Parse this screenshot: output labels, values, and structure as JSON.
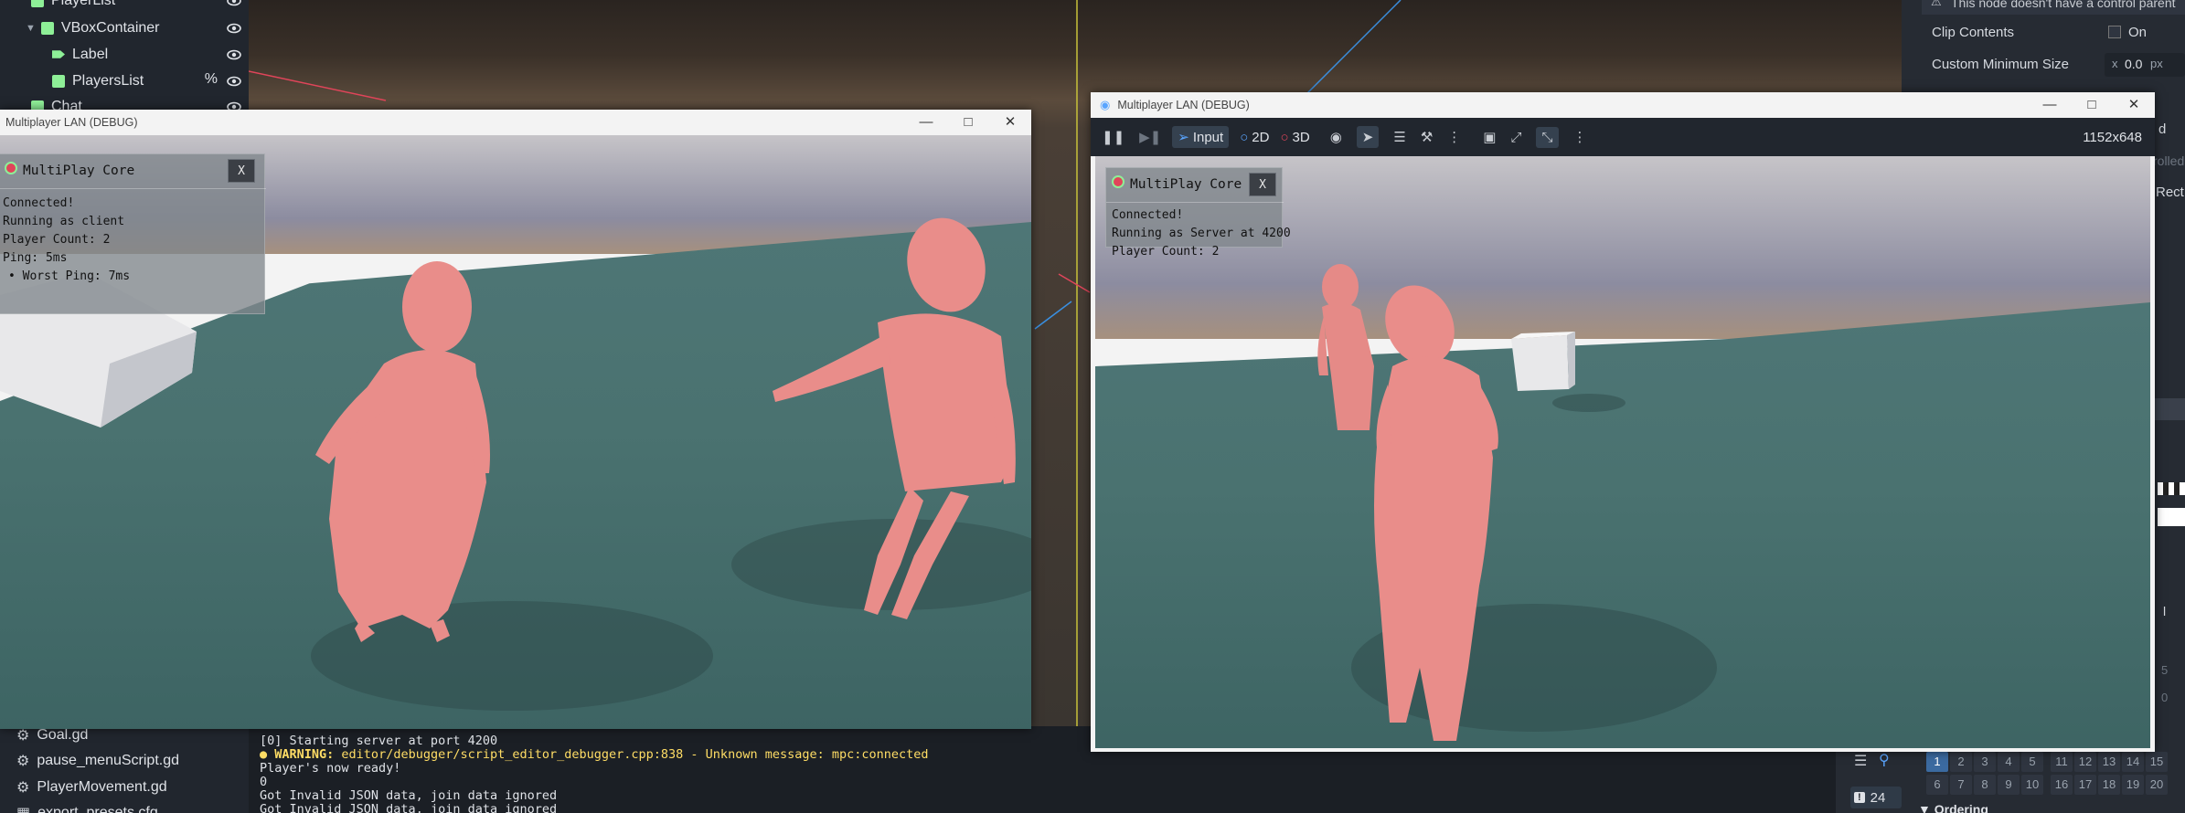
{
  "scene_tree": {
    "items": [
      {
        "label": "PlayerList",
        "depth": 1,
        "color": "#8eef97"
      },
      {
        "label": "VBoxContainer",
        "depth": 2,
        "color": "#8eef97"
      },
      {
        "label": "Label",
        "depth": 3,
        "color": "#8eef97"
      },
      {
        "label": "PlayersList",
        "depth": 3,
        "color": "#8eef97",
        "extra": "%"
      },
      {
        "label": "Chat",
        "depth": 1,
        "color": "#8eef97"
      }
    ]
  },
  "filesystem": {
    "items": [
      "Goal.gd",
      "pause_menuScript.gd",
      "PlayerMovement.gd",
      "export_presets.cfg"
    ]
  },
  "output": {
    "lines": [
      {
        "text": "[0] Starting server at port 4200",
        "kind": "normal"
      },
      {
        "prefix": "WARNING:",
        "text": " editor/debugger/script_editor_debugger.cpp:838 - Unknown message: mpc:connected",
        "kind": "warning"
      },
      {
        "text": "Player's now ready!",
        "kind": "normal"
      },
      {
        "text": "0",
        "kind": "normal"
      },
      {
        "text": "Got Invalid JSON data, join data ignored",
        "kind": "normal"
      },
      {
        "text": "Got Invalid JSON data, join data ignored",
        "kind": "normal"
      }
    ],
    "counter": "24"
  },
  "inspector": {
    "notice": "This node doesn't have a control parent",
    "clip_contents_label": "Clip Contents",
    "clip_contents_value": "On",
    "min_size_label": "Custom Minimum Size",
    "min_size_x_prefix": "x",
    "min_size_x_value": "0.0",
    "min_size_unit": "px",
    "frag_d": "d",
    "frag_rolled": "rolled",
    "frag_rect": "Rect",
    "frag_l": "l",
    "frag_5": "5",
    "frag_0": "0",
    "layers_row1": [
      "1",
      "2",
      "3",
      "4",
      "5",
      "6",
      "7",
      "8",
      "9",
      "10"
    ],
    "layers_row1b": [
      "11",
      "12",
      "13",
      "14",
      "15"
    ],
    "layers_row2": [
      "16",
      "17",
      "18",
      "19",
      "20"
    ],
    "ordering_label": "Ordering"
  },
  "client_window": {
    "title": "Multiplayer LAN (DEBUG)",
    "overlay": {
      "title": "MultiPlay Core",
      "close": "X",
      "lines": [
        "Connected!",
        "Running as client",
        "Player Count: 2",
        "Ping: 5ms",
        "• Worst Ping: 7ms"
      ]
    }
  },
  "server_window": {
    "title": "Multiplayer LAN (DEBUG)",
    "toolbar": {
      "input_label": "Input",
      "2d_label": "2D",
      "3d_label": "3D",
      "resolution": "1152x648"
    },
    "overlay": {
      "title": "MultiPlay Core",
      "close": "X",
      "lines": [
        "Connected!",
        "Running as Server at 4200",
        "Player Count: 2"
      ]
    }
  },
  "colors": {
    "editor_bg": "#21262e",
    "node_green": "#8eef97",
    "warning": "#ffdd65",
    "character_pink": "#e98d8a",
    "floor_teal": "#4a7270"
  }
}
